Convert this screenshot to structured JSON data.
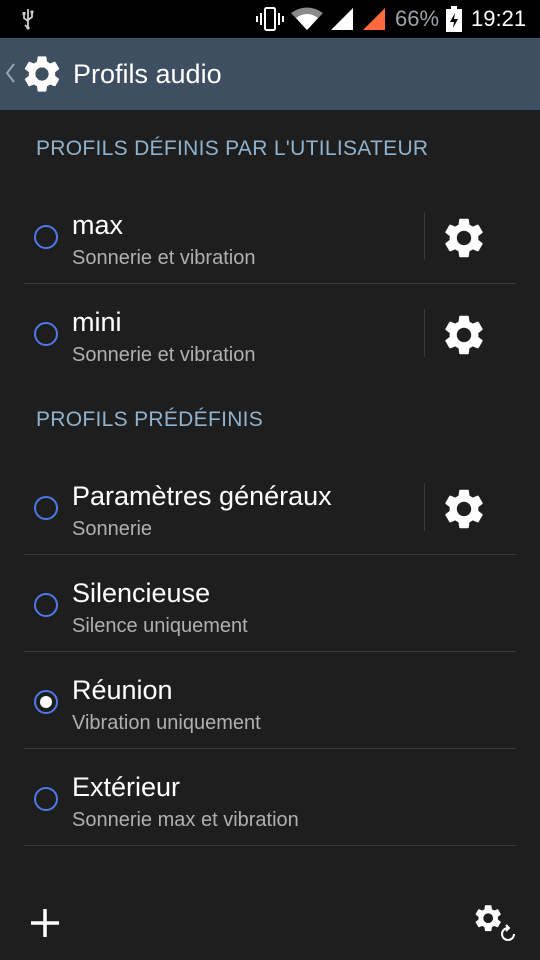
{
  "status_bar": {
    "battery_percent": "66%",
    "time": "19:21"
  },
  "action_bar": {
    "title": "Profils audio"
  },
  "sections": [
    {
      "header": "PROFILS DÉFINIS PAR L'UTILISATEUR",
      "items": [
        {
          "title": "max",
          "subtitle": "Sonnerie et vibration",
          "selected": false,
          "has_settings": true
        },
        {
          "title": "mini",
          "subtitle": "Sonnerie et vibration",
          "selected": false,
          "has_settings": true
        }
      ]
    },
    {
      "header": "PROFILS PRÉDÉFINIS",
      "items": [
        {
          "title": "Paramètres généraux",
          "subtitle": "Sonnerie",
          "selected": false,
          "has_settings": true
        },
        {
          "title": "Silencieuse",
          "subtitle": "Silence uniquement",
          "selected": false,
          "has_settings": false
        },
        {
          "title": "Réunion",
          "subtitle": "Vibration uniquement",
          "selected": true,
          "has_settings": false
        },
        {
          "title": "Extérieur",
          "subtitle": "Sonnerie max et vibration",
          "selected": false,
          "has_settings": false
        }
      ]
    }
  ],
  "colors": {
    "accent_radio": "#4d7ae8",
    "section_header": "#8fb3cf",
    "action_bar": "#3d4f60",
    "cellular_signal": "#ff6a3c"
  }
}
